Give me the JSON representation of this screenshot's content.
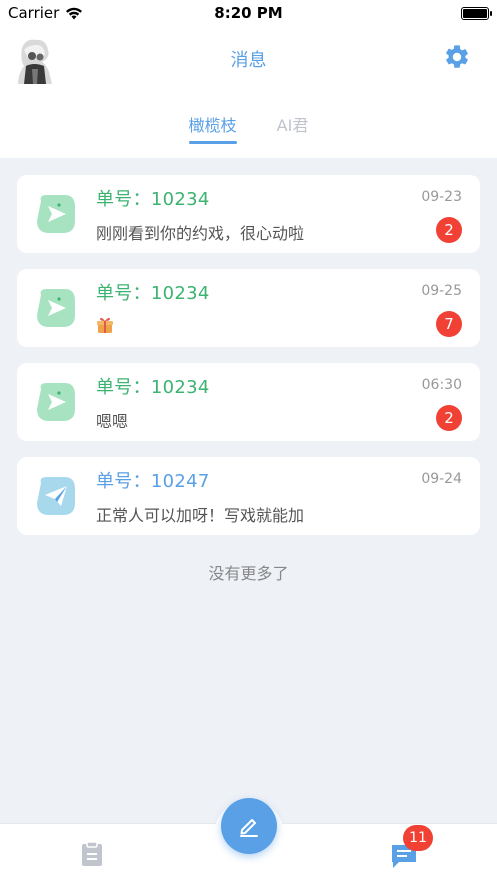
{
  "status_bar": {
    "carrier": "Carrier",
    "time": "8:20 PM"
  },
  "header": {
    "title": "消息",
    "tabs": [
      {
        "label": "橄榄枝",
        "active": true
      },
      {
        "label": "AI君",
        "active": false
      }
    ]
  },
  "messages": [
    {
      "title": "单号：10234",
      "date": "09-23",
      "preview": "刚刚看到你的约戏，很心动啦",
      "badge": "2",
      "accent": "green"
    },
    {
      "title": "单号：10234",
      "date": "09-25",
      "preview": "",
      "badge": "7",
      "accent": "green",
      "preview_icon": "gift-icon"
    },
    {
      "title": "单号：10234",
      "date": "06:30",
      "preview": "嗯嗯",
      "badge": "2",
      "accent": "green"
    },
    {
      "title": "单号：10247",
      "date": "09-24",
      "preview": "正常人可以加呀！写戏就能加",
      "badge": "",
      "accent": "blue"
    }
  ],
  "footer_text": "没有更多了",
  "tabbar": {
    "messages_badge": "11"
  },
  "colors": {
    "primary": "#5aa0e6",
    "green": "#3cb371",
    "badge": "#f04134",
    "background": "#eef1f6"
  }
}
